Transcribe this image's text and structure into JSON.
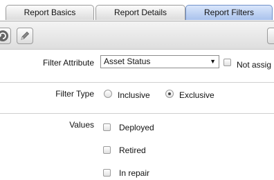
{
  "tabs": [
    {
      "label": "Report Basics",
      "active": false
    },
    {
      "label": "Report Details",
      "active": false
    },
    {
      "label": "Report Filters",
      "active": true
    }
  ],
  "toolbar": {
    "back_icon": "back-arrow-icon",
    "edit_icon": "pencil-icon"
  },
  "filter_attribute": {
    "label": "Filter Attribute",
    "selected": "Asset Status",
    "not_assigned_label": "Not assig"
  },
  "filter_type": {
    "label": "Filter Type",
    "options": [
      {
        "label": "Inclusive",
        "checked": false
      },
      {
        "label": "Exclusive",
        "checked": true
      }
    ]
  },
  "values": {
    "label": "Values",
    "items": [
      "Deployed",
      "Retired",
      "In repair"
    ]
  },
  "colors": {
    "active_tab": "#a9c2ec",
    "border": "#cfcfcf"
  }
}
